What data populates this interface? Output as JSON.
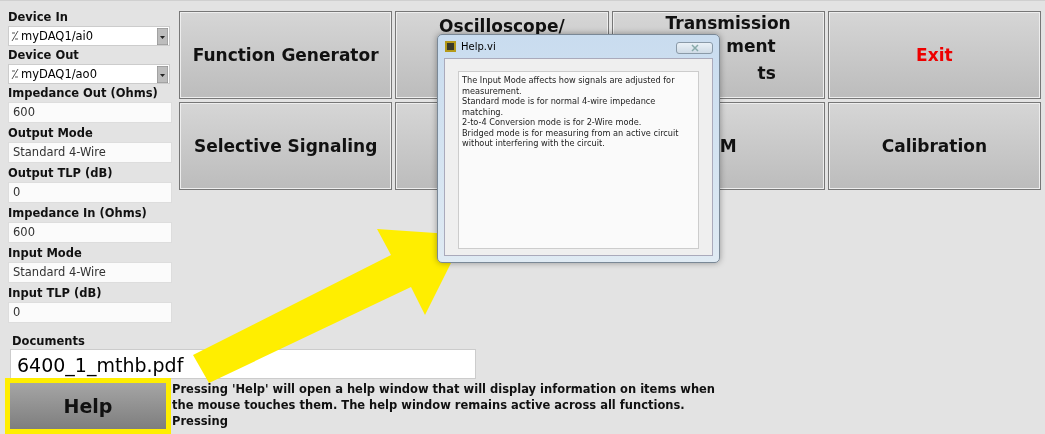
{
  "controls": [
    {
      "label": "Device In",
      "kind": "dropdown",
      "value": "myDAQ1/ai0"
    },
    {
      "label": "Device Out",
      "kind": "dropdown",
      "value": "myDAQ1/ao0"
    },
    {
      "label": "Impedance Out (Ohms)",
      "kind": "text",
      "value": "600"
    },
    {
      "label": "Output Mode",
      "kind": "text",
      "value": "Standard 4-Wire"
    },
    {
      "label": "Output TLP (dB)",
      "kind": "text",
      "value": "0"
    },
    {
      "label": "Impedance In (Ohms)",
      "kind": "text",
      "value": "600"
    },
    {
      "label": "Input Mode",
      "kind": "text",
      "value": "Standard 4-Wire"
    },
    {
      "label": "Input TLP (dB)",
      "kind": "text",
      "value": "0"
    }
  ],
  "documents": {
    "label": "Documents",
    "value": "6400_1_mthb.pdf"
  },
  "buttons": [
    {
      "kind": "normal",
      "lines": [
        "Function Generator"
      ]
    },
    {
      "kind": "top",
      "lines": [
        "Oscilloscope/"
      ]
    },
    {
      "kind": "right",
      "lines": [
        "Transmission",
        "ment",
        "ts"
      ]
    },
    {
      "kind": "exit",
      "lines": [
        "Exit"
      ]
    },
    {
      "kind": "normal",
      "lines": [
        "Selective Signaling"
      ]
    },
    {
      "kind": "hidden"
    },
    {
      "kind": "right",
      "lines": [
        "M"
      ]
    },
    {
      "kind": "normal",
      "lines": [
        "Calibration"
      ]
    }
  ],
  "help_button": {
    "label": "Help",
    "highlighted": true
  },
  "help_note": [
    "Pressing 'Help' will open a help window that will display information on items when",
    "the mouse touches them. The help window remains active across all functions.",
    "Pressing"
  ],
  "help_window": {
    "title": "Help.vi",
    "text": [
      "The Input Mode affects how signals are adjusted for measurement.",
      "Standard mode is for normal 4-wire impedance matching.",
      "2-to-4 Conversion mode is for 2-Wire mode.",
      "Bridged mode is for measuring from an active circuit without interfering with the circuit."
    ]
  }
}
